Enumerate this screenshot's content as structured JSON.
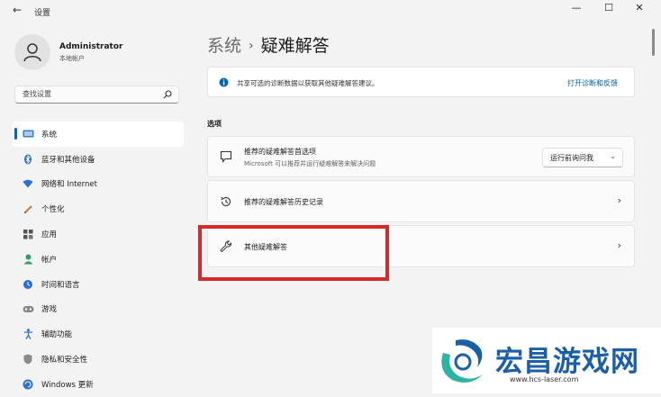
{
  "app": {
    "title": "设置",
    "back_icon": "back-arrow-icon"
  },
  "window_controls": {
    "minimize": "—",
    "maximize": "☐",
    "close": "✕"
  },
  "profile": {
    "name": "Administrator",
    "account": "本地帐户"
  },
  "search": {
    "placeholder": "查找设置",
    "icon": "search-icon"
  },
  "sidebar": {
    "items": [
      {
        "label": "系统",
        "icon": "system-icon",
        "selected": true
      },
      {
        "label": "蓝牙和其他设备",
        "icon": "bluetooth-icon"
      },
      {
        "label": "网络和 Internet",
        "icon": "wifi-icon"
      },
      {
        "label": "个性化",
        "icon": "pen-icon"
      },
      {
        "label": "应用",
        "icon": "apps-icon"
      },
      {
        "label": "帐户",
        "icon": "account-icon"
      },
      {
        "label": "时间和语言",
        "icon": "time-language-icon"
      },
      {
        "label": "游戏",
        "icon": "gaming-icon"
      },
      {
        "label": "辅助功能",
        "icon": "accessibility-icon"
      },
      {
        "label": "隐私和安全性",
        "icon": "privacy-shield-icon"
      },
      {
        "label": "Windows 更新",
        "icon": "windows-update-icon"
      }
    ]
  },
  "breadcrumb": {
    "parent": "系统",
    "separator": "›",
    "current": "疑难解答"
  },
  "info_bar": {
    "text": "共享可选的诊断数据以获取其他疑难解答建议。",
    "link": "打开诊断和反馈"
  },
  "section": {
    "label": "选项"
  },
  "cards": [
    {
      "title": "推荐的疑难解答首选项",
      "subtitle": "Microsoft 可以推荐并运行疑难解答来解决问题",
      "dropdown_value": "运行前询问我",
      "icon": "chat-bubble-icon"
    },
    {
      "title": "推荐的疑难解答历史记录",
      "icon": "history-icon"
    },
    {
      "title": "其他疑难解答",
      "icon": "wrench-icon"
    }
  ],
  "chevron": "›",
  "watermark": {
    "title": "宏昌游戏网",
    "url": "www.hcs-laser.com"
  },
  "colors": {
    "accent": "#0067c0",
    "highlight_box": "#d42a2a",
    "watermark": "#1b5fa8",
    "background": "#f3f3f3"
  }
}
